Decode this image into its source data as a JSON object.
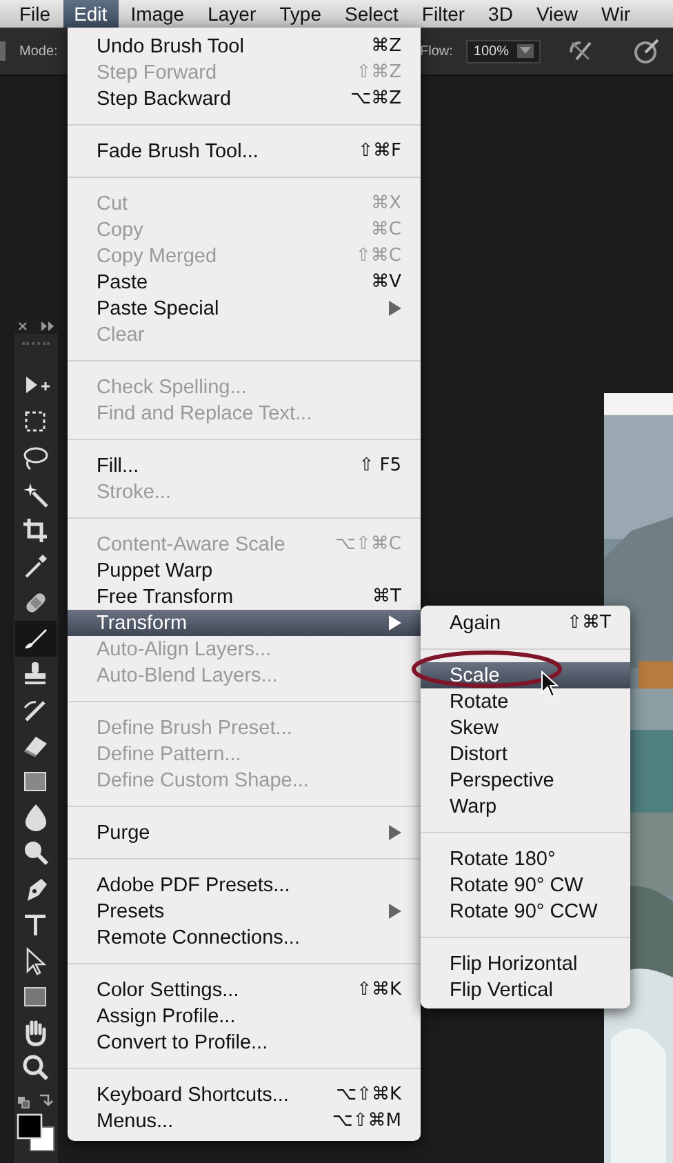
{
  "menubar": [
    {
      "label": "File",
      "selected": false
    },
    {
      "label": "Edit",
      "selected": true
    },
    {
      "label": "Image",
      "selected": false
    },
    {
      "label": "Layer",
      "selected": false
    },
    {
      "label": "Type",
      "selected": false
    },
    {
      "label": "Select",
      "selected": false
    },
    {
      "label": "Filter",
      "selected": false
    },
    {
      "label": "3D",
      "selected": false
    },
    {
      "label": "View",
      "selected": false
    },
    {
      "label": "Wir",
      "selected": false
    }
  ],
  "options_bar": {
    "mode_label": "Mode:",
    "flow_label": "Flow:",
    "flow_value": "100%"
  },
  "tools": [
    {
      "kind": "move",
      "selected": false
    },
    {
      "kind": "marquee",
      "selected": false
    },
    {
      "kind": "lasso",
      "selected": false
    },
    {
      "kind": "wand",
      "selected": false
    },
    {
      "kind": "crop",
      "selected": false
    },
    {
      "kind": "eyedropper",
      "selected": false
    },
    {
      "kind": "bandage",
      "selected": false
    },
    {
      "kind": "brush",
      "selected": true
    },
    {
      "kind": "stamp",
      "selected": false
    },
    {
      "kind": "history",
      "selected": false
    },
    {
      "kind": "eraser",
      "selected": false
    },
    {
      "kind": "gradient",
      "selected": false
    },
    {
      "kind": "drop",
      "selected": false
    },
    {
      "kind": "dodge",
      "selected": false
    },
    {
      "kind": "pen",
      "selected": false
    },
    {
      "kind": "type",
      "selected": false
    },
    {
      "kind": "pathselect",
      "selected": false
    },
    {
      "kind": "rectangle",
      "selected": false
    },
    {
      "kind": "hand",
      "selected": false
    },
    {
      "kind": "zoom",
      "selected": false
    }
  ],
  "edit_menu": [
    [
      {
        "label": "Undo Brush Tool",
        "shortcut": "⌘Z",
        "disabled": false,
        "submenu": false,
        "selected": false
      },
      {
        "label": "Step Forward",
        "shortcut": "⇧⌘Z",
        "disabled": true,
        "submenu": false,
        "selected": false
      },
      {
        "label": "Step Backward",
        "shortcut": "⌥⌘Z",
        "disabled": false,
        "submenu": false,
        "selected": false
      }
    ],
    [
      {
        "label": "Fade Brush Tool...",
        "shortcut": "⇧⌘F",
        "disabled": false,
        "submenu": false,
        "selected": false
      }
    ],
    [
      {
        "label": "Cut",
        "shortcut": "⌘X",
        "disabled": true,
        "submenu": false,
        "selected": false
      },
      {
        "label": "Copy",
        "shortcut": "⌘C",
        "disabled": true,
        "submenu": false,
        "selected": false
      },
      {
        "label": "Copy Merged",
        "shortcut": "⇧⌘C",
        "disabled": true,
        "submenu": false,
        "selected": false
      },
      {
        "label": "Paste",
        "shortcut": "⌘V",
        "disabled": false,
        "submenu": false,
        "selected": false
      },
      {
        "label": "Paste Special",
        "disabled": false,
        "submenu": true,
        "selected": false
      },
      {
        "label": "Clear",
        "disabled": true,
        "submenu": false,
        "selected": false
      }
    ],
    [
      {
        "label": "Check Spelling...",
        "disabled": true,
        "submenu": false,
        "selected": false
      },
      {
        "label": "Find and Replace Text...",
        "disabled": true,
        "submenu": false,
        "selected": false
      }
    ],
    [
      {
        "label": "Fill...",
        "shortcut": "⇧ F5",
        "disabled": false,
        "submenu": false,
        "selected": false
      },
      {
        "label": "Stroke...",
        "disabled": true,
        "submenu": false,
        "selected": false
      }
    ],
    [
      {
        "label": "Content-Aware Scale",
        "shortcut": "⌥⇧⌘C",
        "disabled": true,
        "submenu": false,
        "selected": false
      },
      {
        "label": "Puppet Warp",
        "disabled": false,
        "submenu": false,
        "selected": false
      },
      {
        "label": "Free Transform",
        "shortcut": "⌘T",
        "disabled": false,
        "submenu": false,
        "selected": false
      },
      {
        "label": "Transform",
        "disabled": false,
        "submenu": true,
        "selected": true
      },
      {
        "label": "Auto-Align Layers...",
        "disabled": true,
        "submenu": false,
        "selected": false
      },
      {
        "label": "Auto-Blend Layers...",
        "disabled": true,
        "submenu": false,
        "selected": false
      }
    ],
    [
      {
        "label": "Define Brush Preset...",
        "disabled": true,
        "submenu": false,
        "selected": false
      },
      {
        "label": "Define Pattern...",
        "disabled": true,
        "submenu": false,
        "selected": false
      },
      {
        "label": "Define Custom Shape...",
        "disabled": true,
        "submenu": false,
        "selected": false
      }
    ],
    [
      {
        "label": "Purge",
        "disabled": false,
        "submenu": true,
        "selected": false
      }
    ],
    [
      {
        "label": "Adobe PDF Presets...",
        "disabled": false,
        "submenu": false,
        "selected": false
      },
      {
        "label": "Presets",
        "disabled": false,
        "submenu": true,
        "selected": false
      },
      {
        "label": "Remote Connections...",
        "disabled": false,
        "submenu": false,
        "selected": false
      }
    ],
    [
      {
        "label": "Color Settings...",
        "shortcut": "⇧⌘K",
        "disabled": false,
        "submenu": false,
        "selected": false
      },
      {
        "label": "Assign Profile...",
        "disabled": false,
        "submenu": false,
        "selected": false
      },
      {
        "label": "Convert to Profile...",
        "disabled": false,
        "submenu": false,
        "selected": false
      }
    ],
    [
      {
        "label": "Keyboard Shortcuts...",
        "shortcut": "⌥⇧⌘K",
        "disabled": false,
        "submenu": false,
        "selected": false
      },
      {
        "label": "Menus...",
        "shortcut": "⌥⇧⌘M",
        "disabled": false,
        "submenu": false,
        "selected": false
      }
    ]
  ],
  "transform_submenu": [
    [
      {
        "label": "Again",
        "shortcut": "⇧⌘T",
        "selected": false
      }
    ],
    [
      {
        "label": "Scale",
        "selected": true
      },
      {
        "label": "Rotate",
        "selected": false
      },
      {
        "label": "Skew",
        "selected": false
      },
      {
        "label": "Distort",
        "selected": false
      },
      {
        "label": "Perspective",
        "selected": false
      },
      {
        "label": "Warp",
        "selected": false
      }
    ],
    [
      {
        "label": "Rotate 180°",
        "selected": false
      },
      {
        "label": "Rotate 90° CW",
        "selected": false
      },
      {
        "label": "Rotate 90° CCW",
        "selected": false
      }
    ],
    [
      {
        "label": "Flip Horizontal",
        "selected": false
      },
      {
        "label": "Flip Vertical",
        "selected": false
      }
    ]
  ]
}
